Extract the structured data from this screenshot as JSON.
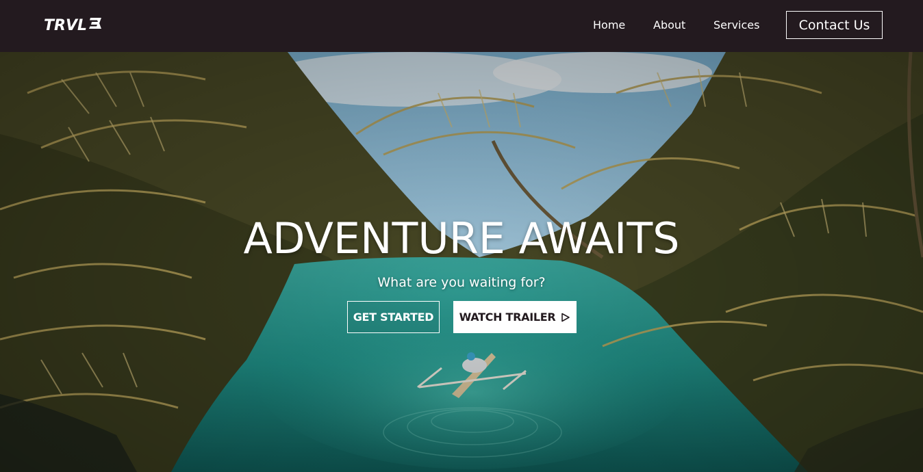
{
  "nav": {
    "logo_text": "TRVL",
    "links": [
      {
        "label": "Home"
      },
      {
        "label": "About"
      },
      {
        "label": "Services"
      }
    ],
    "contact_label": "Contact Us"
  },
  "hero": {
    "title": "ADVENTURE AWAITS",
    "subtitle": "What are you waiting for?",
    "primary_button": "GET STARTED",
    "secondary_button": "WATCH TRAILER",
    "secondary_button_icon": "play-icon",
    "background_scene": "tropical-river-palms-boat"
  },
  "colors": {
    "navbar_bg": "#231a1f",
    "text_light": "#ffffff",
    "button_dark_text": "#231a1f",
    "water": "#1f8f86"
  }
}
